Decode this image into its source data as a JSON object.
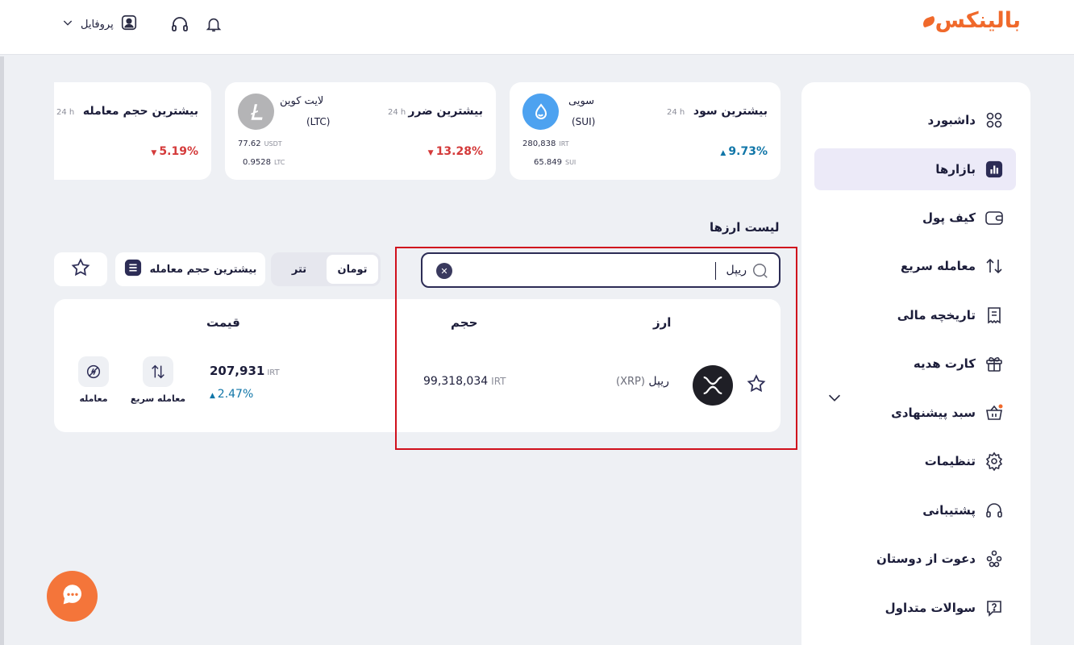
{
  "header": {
    "logo_text": "بالینکس",
    "profile_label": "پروفایل",
    "icons": [
      "bell-icon",
      "headset-icon",
      "user-icon",
      "chevron-down-icon"
    ]
  },
  "sidebar": {
    "items": [
      {
        "label": "داشبورد",
        "icon": "grid-icon"
      },
      {
        "label": "بازارها",
        "icon": "chart-icon",
        "active": true
      },
      {
        "label": "کیف پول",
        "icon": "wallet-icon"
      },
      {
        "label": "معامله سریع",
        "icon": "swap-icon"
      },
      {
        "label": "تاریخچه مالی",
        "icon": "receipt-icon"
      },
      {
        "label": "کارت هدیه",
        "icon": "gift-icon"
      },
      {
        "label": "سبد پیشنهادی",
        "icon": "basket-icon"
      },
      {
        "label": "تنظیمات",
        "icon": "gear-icon"
      },
      {
        "label": "پشتیبانی",
        "icon": "headset-icon"
      },
      {
        "label": "دعوت از دوستان",
        "icon": "friends-icon"
      },
      {
        "label": "سوالات متداول",
        "icon": "help-icon"
      }
    ]
  },
  "cards": [
    {
      "title": "بیشترین سود",
      "period": "24 h",
      "change": "9.73%",
      "direction": "up",
      "coin_name": "سویی",
      "coin_symbol": "(SUI)",
      "val1": "280,838",
      "val1_unit": "IRT",
      "val2": "65.849",
      "val2_unit": "SUI"
    },
    {
      "title": "بیشترین ضرر",
      "period": "24 h",
      "change": "13.28%",
      "direction": "down",
      "coin_name": "لایت کوین",
      "coin_symbol": "(LTC)",
      "val1": "77.62",
      "val1_unit": "USDT",
      "val2": "0.9528",
      "val2_unit": "LTC"
    },
    {
      "title": "بیشترین حجم معامله",
      "period": "24 h",
      "change": "5.19%",
      "direction": "down"
    }
  ],
  "list": {
    "title": "لیست ارزها",
    "search_value": "ریپل",
    "currency_options": [
      "تومان",
      "تتر"
    ],
    "sort_label": "بیشترین حجم معامله",
    "columns": {
      "coin": "ارز",
      "volume": "حجم",
      "price": "قیمت"
    },
    "rows": [
      {
        "name": "ریپل",
        "symbol": "(XRP)",
        "volume": "99,318,034",
        "volume_unit": "IRT",
        "price": "207,931",
        "price_unit": "IRT",
        "change": "2.47%",
        "actions": {
          "quick_trade": "معامله سریع",
          "trade": "معامله"
        }
      }
    ]
  },
  "colors": {
    "brand": "#f0692b",
    "up": "#1176a8",
    "down": "#d43a3a",
    "highlight": "#d0101c",
    "active_nav_bg": "#eceaf8"
  }
}
